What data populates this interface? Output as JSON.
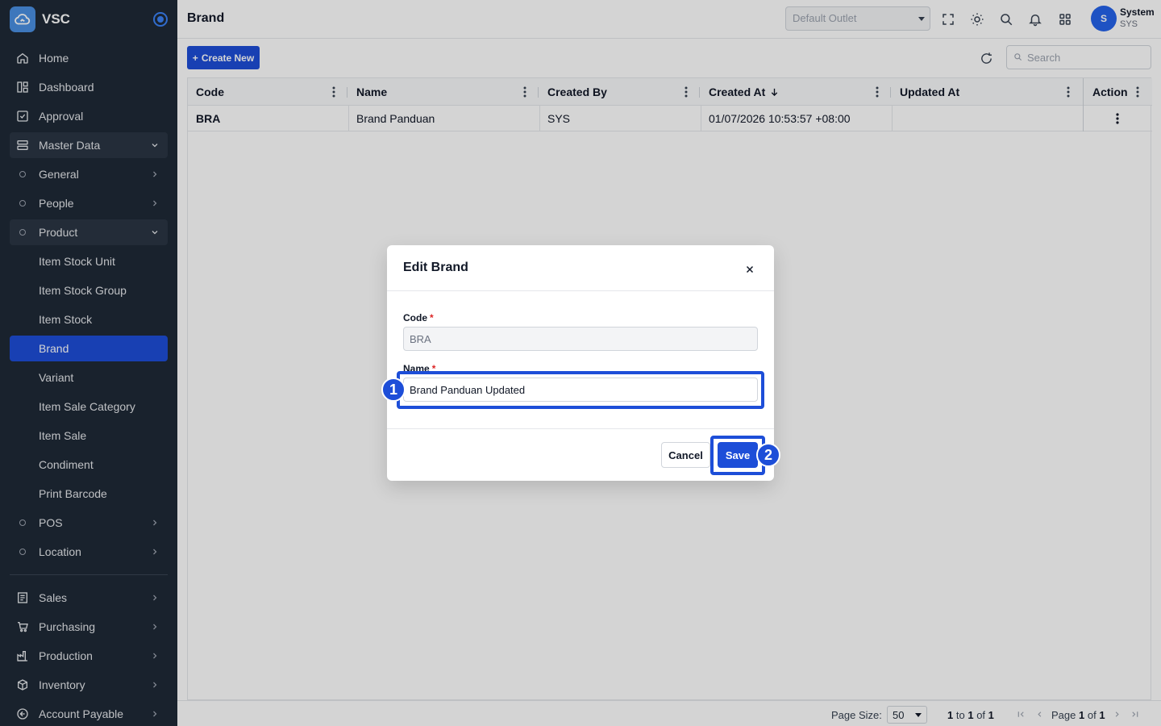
{
  "app": {
    "name": "VSC"
  },
  "sidebar": {
    "items": [
      {
        "label": "Home",
        "icon": "home-icon"
      },
      {
        "label": "Dashboard",
        "icon": "dashboard-icon"
      },
      {
        "label": "Approval",
        "icon": "approval-icon"
      },
      {
        "label": "Master Data",
        "icon": "server-icon"
      },
      {
        "label": "General"
      },
      {
        "label": "People"
      },
      {
        "label": "Product"
      },
      {
        "label": "Item Stock Unit"
      },
      {
        "label": "Item Stock Group"
      },
      {
        "label": "Item Stock"
      },
      {
        "label": "Brand"
      },
      {
        "label": "Variant"
      },
      {
        "label": "Item Sale Category"
      },
      {
        "label": "Item Sale"
      },
      {
        "label": "Condiment"
      },
      {
        "label": "Print Barcode"
      },
      {
        "label": "POS"
      },
      {
        "label": "Location"
      },
      {
        "label": "Sales",
        "icon": "receipt-icon"
      },
      {
        "label": "Purchasing",
        "icon": "cart-icon"
      },
      {
        "label": "Production",
        "icon": "factory-icon"
      },
      {
        "label": "Inventory",
        "icon": "box-icon"
      },
      {
        "label": "Account Payable",
        "icon": "arrow-left-circle-icon"
      }
    ]
  },
  "header": {
    "title": "Brand",
    "outlet_placeholder": "Default Outlet",
    "user_name": "System",
    "user_code": "SYS",
    "avatar_letter": "S"
  },
  "toolbar": {
    "create_label": "Create New",
    "search_placeholder": "Search"
  },
  "table": {
    "columns": [
      "Code",
      "Name",
      "Created By",
      "Created At",
      "Updated At",
      "Action"
    ],
    "rows": [
      {
        "code": "BRA",
        "name": "Brand Panduan",
        "created_by": "SYS",
        "created_at": "01/07/2026 10:53:57 +08:00",
        "updated_at": ""
      }
    ]
  },
  "footer": {
    "page_size_label": "Page Size:",
    "page_size_value": "50",
    "range_from": "1",
    "range_to_label": "to",
    "range_to": "1",
    "range_of_label": "of",
    "range_total": "1",
    "page_label": "Page",
    "page_current": "1",
    "page_of_label": "of",
    "page_total": "1"
  },
  "modal": {
    "title": "Edit Brand",
    "code_label": "Code",
    "code_value": "BRA",
    "name_label": "Name",
    "name_value": "Brand Panduan Updated",
    "cancel_label": "Cancel",
    "save_label": "Save"
  },
  "annotations": {
    "step1": "1",
    "step2": "2"
  },
  "colors": {
    "sidebar_bg": "#1f2a37",
    "accent": "#1d4ed8",
    "active_item": "#1d4ed8"
  }
}
